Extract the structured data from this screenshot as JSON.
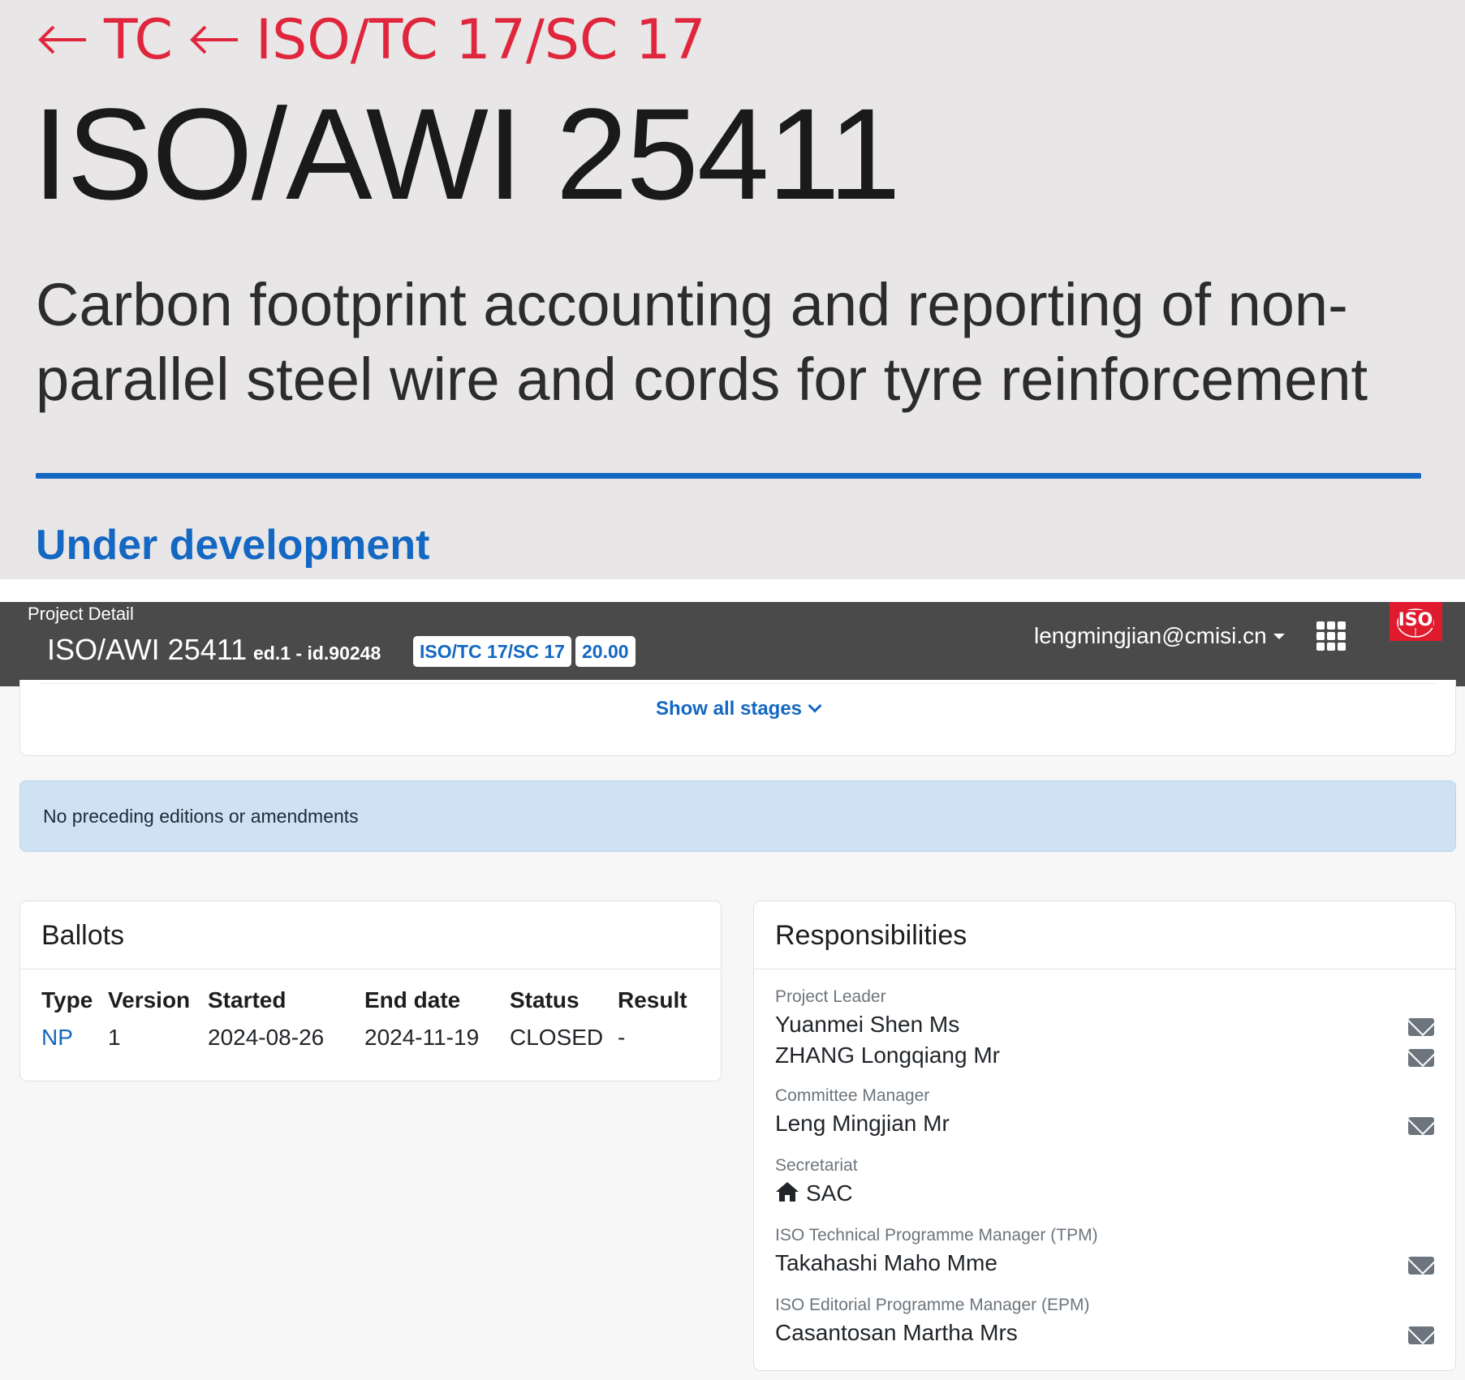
{
  "breadcrumb": {
    "items": [
      "TC",
      "ISO/TC 17/SC 17"
    ]
  },
  "standard": {
    "title": "ISO/AWI 25411",
    "subtitle": "Carbon footprint accounting and reporting of non-parallel steel wire and cords for tyre reinforcement",
    "status": "Under development"
  },
  "project_bar": {
    "label": "Project Detail",
    "title": "ISO/AWI 25411",
    "reference": "ed.1 - id.90248",
    "committee_badge": "ISO/TC 17/SC 17",
    "stage_badge": "20.00",
    "user": "lengmingjian@cmisi.cn",
    "logo_text": "ISO"
  },
  "stages": {
    "show_all_label": "Show all stages"
  },
  "alert": {
    "text": "No preceding editions or amendments"
  },
  "ballots": {
    "title": "Ballots",
    "columns": [
      "Type",
      "Version",
      "Started",
      "End date",
      "Status",
      "Result"
    ],
    "rows": [
      [
        "NP",
        "1",
        "2024-08-26",
        "2024-11-19",
        "CLOSED",
        "-"
      ]
    ]
  },
  "responsibilities": {
    "title": "Responsibilities",
    "project_leader_label": "Project Leader",
    "project_leaders": [
      "Yuanmei Shen Ms",
      "ZHANG Longqiang Mr"
    ],
    "committee_manager_label": "Committee Manager",
    "committee_manager": "Leng Mingjian Mr",
    "secretariat_label": "Secretariat",
    "secretariat": "SAC",
    "tpm_label": "ISO Technical Programme Manager (TPM)",
    "tpm": "Takahashi Maho Mme",
    "epm_label": "ISO Editorial Programme Manager (EPM)",
    "epm": "Casantosan Martha Mrs"
  },
  "colors": {
    "accent_red": "#e0263c",
    "accent_blue": "#1467c2",
    "bar_background": "#4b4a4b",
    "alert_background": "#cfe2f3"
  },
  "icons": [
    "arrow-left-icon",
    "apps-grid-icon",
    "chevron-down-icon",
    "mail-icon",
    "home-icon",
    "caret-down-icon"
  ]
}
